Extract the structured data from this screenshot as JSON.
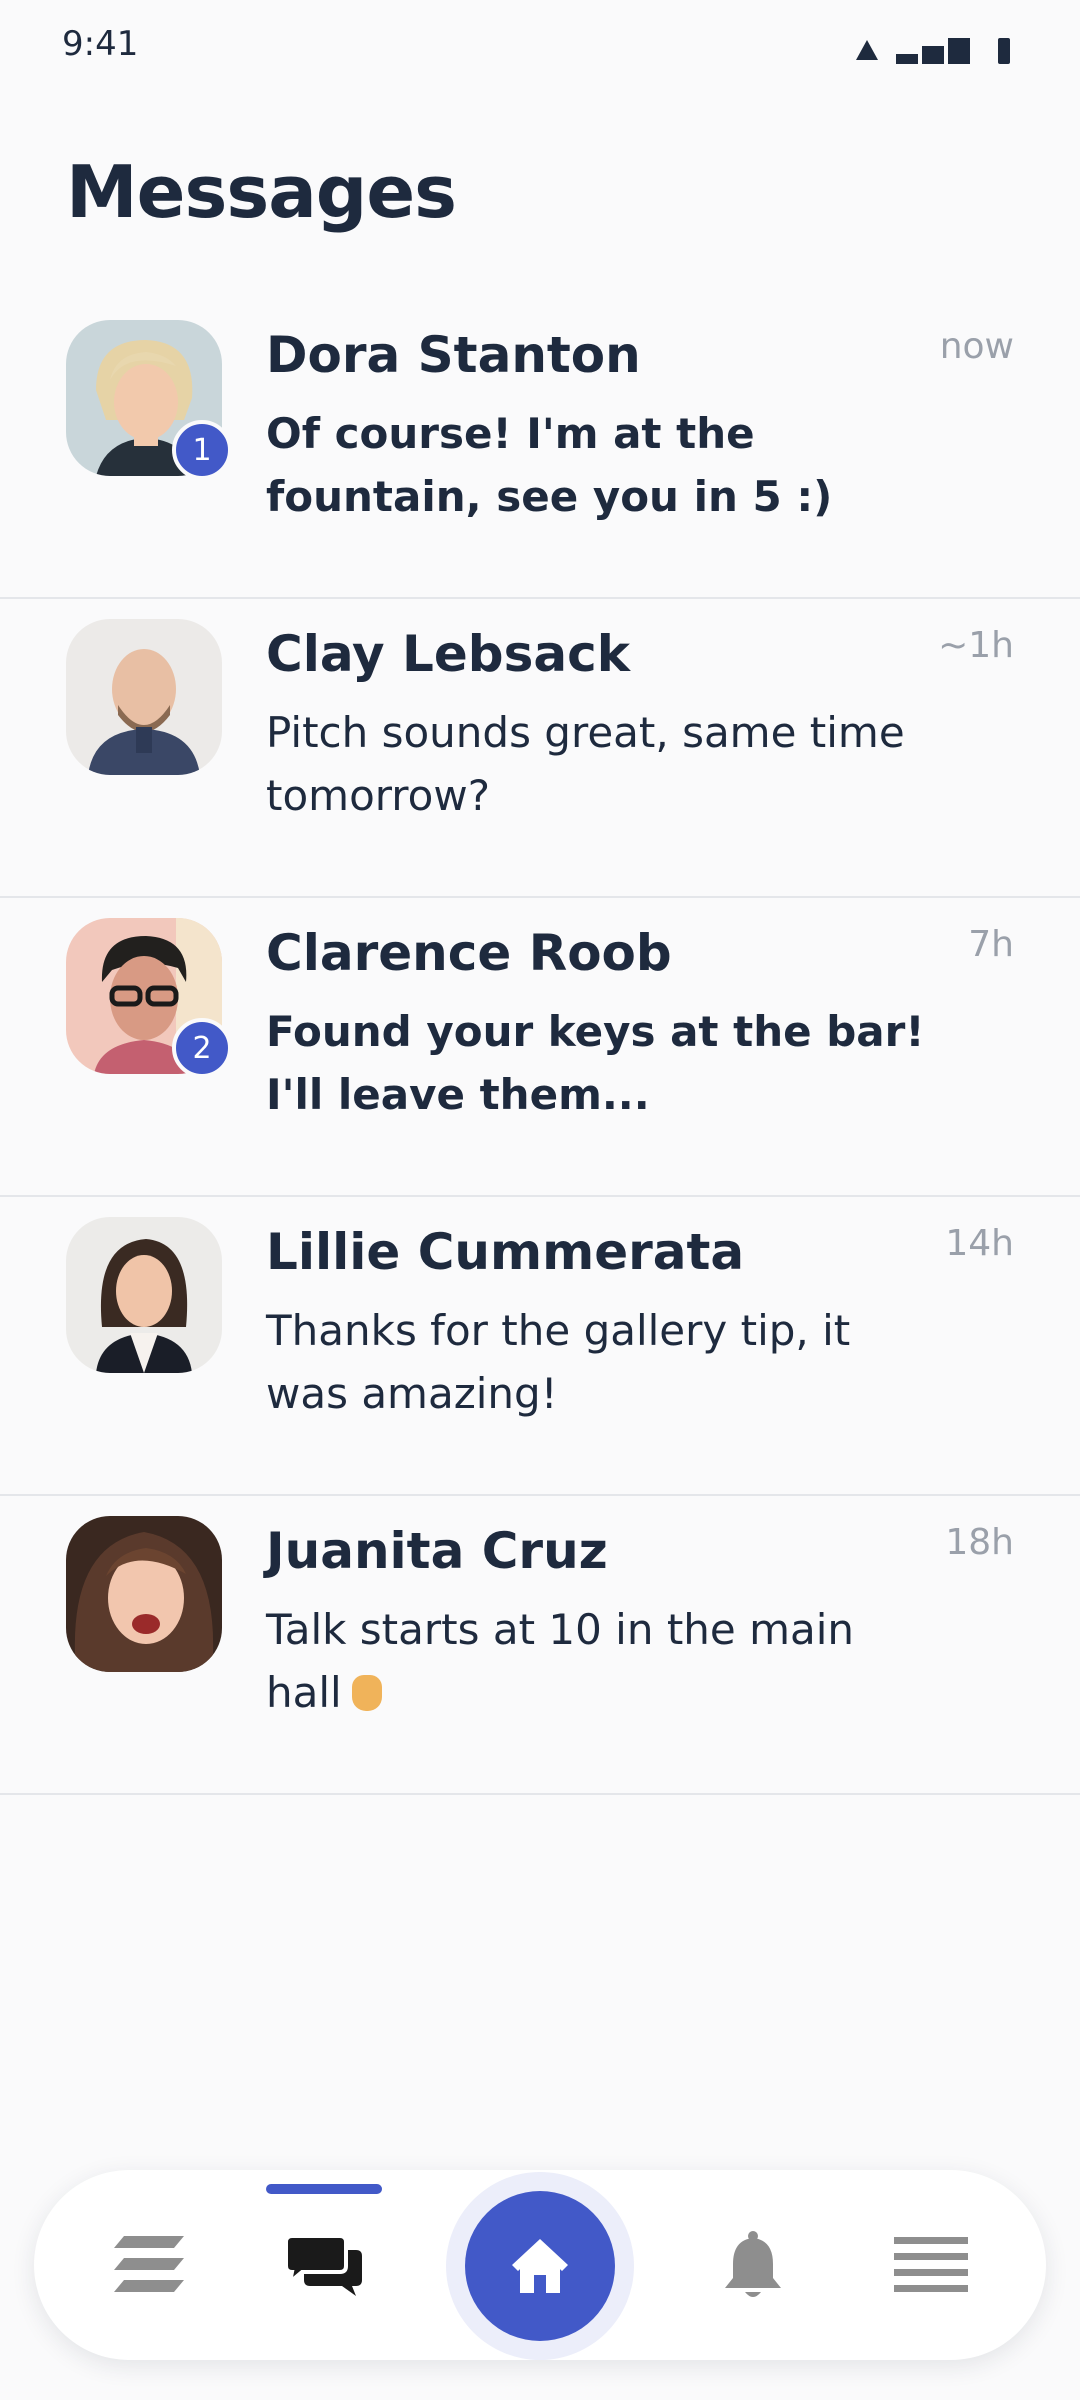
{
  "status_bar": {
    "time": "9:41"
  },
  "page": {
    "title": "Messages"
  },
  "messages": [
    {
      "name": "Dora Stanton",
      "preview": "Of course! I'm at the fountain, see you in 5 :)",
      "time": "now",
      "unread_count": "1",
      "unread": true
    },
    {
      "name": "Clay Lebsack",
      "preview": "Pitch sounds great, same time tomorrow?",
      "time": "~1h",
      "unread": false
    },
    {
      "name": "Clarence Roob",
      "preview": "Found your keys at the bar! I'll leave them...",
      "time": "7h",
      "unread_count": "2",
      "unread": true
    },
    {
      "name": "Lillie Cummerata",
      "preview": "Thanks for the gallery tip, it was amazing!",
      "time": "14h",
      "unread": false
    },
    {
      "name": "Juanita Cruz",
      "preview": "Talk starts at 10 in the main hall",
      "time": "18h",
      "unread": false
    }
  ],
  "bottom_nav": {
    "items": [
      {
        "icon": "feed-icon"
      },
      {
        "icon": "chat-icon",
        "active": true
      },
      {
        "icon": "home-icon"
      },
      {
        "icon": "bell-icon"
      },
      {
        "icon": "menu-icon"
      }
    ]
  },
  "colors": {
    "accent": "#4259c8",
    "text": "#1e2a3e",
    "muted": "#9aa0aa"
  }
}
